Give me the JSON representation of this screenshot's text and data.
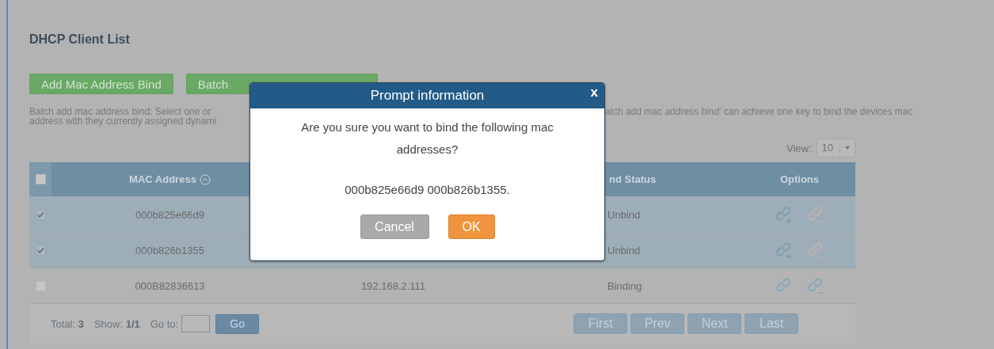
{
  "page": {
    "title": "DHCP Client List"
  },
  "actions": [
    {
      "label": "Add Mac Address Bind"
    },
    {
      "label": "Batch"
    }
  ],
  "description": {
    "left_lines": [
      "Batch add mac address bind: Select one or",
      "address with they currently assigned dynami"
    ],
    "right_text": "atch add mac address bind' can achieve one key to bind the devices mac"
  },
  "view": {
    "label": "View:",
    "value": "10"
  },
  "table": {
    "header_checked": false,
    "columns": [
      {
        "kind": "mac",
        "label": "MAC Address",
        "sorted": true
      },
      {
        "kind": "status",
        "label": "nd Status"
      },
      {
        "kind": "options",
        "label": "Options"
      }
    ],
    "rows": [
      {
        "selected": true,
        "checked": true,
        "mac": "000b825e66d9",
        "status": "Unbind",
        "options": [
          {
            "kind": "bind",
            "disabled": false
          },
          {
            "kind": "unbind",
            "disabled": true
          }
        ]
      },
      {
        "selected": true,
        "checked": true,
        "mac": "000b826b1355",
        "status": "Unbind",
        "options": [
          {
            "kind": "bind",
            "disabled": false
          },
          {
            "kind": "unbind",
            "disabled": true
          }
        ]
      },
      {
        "selected": false,
        "checked": false,
        "mac": "000B82836613",
        "ip": "192.168.2.111",
        "status": "Binding",
        "options": [
          {
            "kind": "link",
            "disabled": false
          },
          {
            "kind": "unbind",
            "disabled": false
          }
        ]
      }
    ]
  },
  "footer": {
    "total": "Total: **3**",
    "show": "Show: **1/1**",
    "goto_label": "Go to:",
    "go": "Go",
    "pages": [
      {
        "label": "First",
        "disabled": true
      },
      {
        "label": "Prev",
        "disabled": true
      },
      {
        "label": "Next",
        "disabled": true
      },
      {
        "label": "Last",
        "disabled": true
      }
    ]
  },
  "dialog": {
    "title": "Prompt information",
    "close": "x",
    "message": "Are you sure you want to bind the following mac addresses?",
    "addresses": "000b825e66d9 000b826b1355.",
    "buttons": [
      {
        "kind": "cancel",
        "label": "Cancel"
      },
      {
        "kind": "ok",
        "label": "OK"
      }
    ]
  }
}
